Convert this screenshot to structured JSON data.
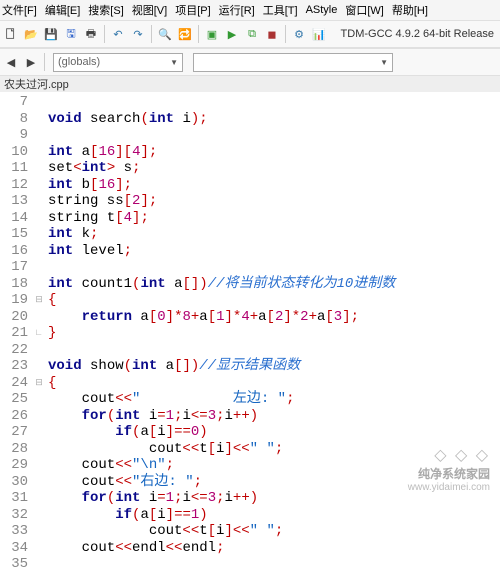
{
  "menus": {
    "file": "文件[F]",
    "edit": "编辑[E]",
    "search": "搜索[S]",
    "view": "视图[V]",
    "project": "项目[P]",
    "run": "运行[R]",
    "tools": "工具[T]",
    "astyle": "AStyle",
    "window": "窗口[W]",
    "help": "帮助[H]"
  },
  "combo": {
    "globals": "(globals)"
  },
  "compiler_label": "TDM-GCC 4.9.2 64-bit Release",
  "tab_title": "农夫过河.cpp",
  "line_start": 7,
  "code_lines": [
    "",
    "<kw>void</kw> <fn>search</fn><pun>(</pun><type>int</type> i<pun>)</pun><pun>;</pun>",
    "",
    "<type>int</type> a<pun>[</pun><num>16</num><pun>]</pun><pun>[</pun><num>4</num><pun>]</pun><pun>;</pun>",
    "set<pun>&lt;</pun><type>int</type><pun>&gt;</pun> s<pun>;</pun>",
    "<type>int</type> b<pun>[</pun><num>16</num><pun>]</pun><pun>;</pun>",
    "string ss<pun>[</pun><num>2</num><pun>]</pun><pun>;</pun>",
    "string t<pun>[</pun><num>4</num><pun>]</pun><pun>;</pun>",
    "<type>int</type> k<pun>;</pun>",
    "<type>int</type> level<pun>;</pun>",
    "",
    "<type>int</type> <fn>count1</fn><pun>(</pun><type>int</type> a<pun>[</pun><pun>]</pun><pun>)</pun><cmt>//将当前状态转化为10进制数</cmt>",
    "<pun>{</pun>",
    "    <kw>return</kw> a<pun>[</pun><num>0</num><pun>]</pun><pun>*</pun><num>8</num><pun>+</pun>a<pun>[</pun><num>1</num><pun>]</pun><pun>*</pun><num>4</num><pun>+</pun>a<pun>[</pun><num>2</num><pun>]</pun><pun>*</pun><num>2</num><pun>+</pun>a<pun>[</pun><num>3</num><pun>]</pun><pun>;</pun>",
    "<pun>}</pun>",
    "",
    "<kw>void</kw> <fn>show</fn><pun>(</pun><type>int</type> a<pun>[</pun><pun>]</pun><pun>)</pun><cmt>//显示结果函数</cmt>",
    "<pun>{</pun>",
    "    cout<pun>&lt;&lt;</pun><str>\"           左边: \"</str><pun>;</pun>",
    "    <kw>for</kw><pun>(</pun><type>int</type> i<pun>=</pun><num>1</num><pun>;</pun>i<pun>&lt;=</pun><num>3</num><pun>;</pun>i<pun>++</pun><pun>)</pun>",
    "        <kw>if</kw><pun>(</pun>a<pun>[</pun>i<pun>]</pun><pun>==</pun><num>0</num><pun>)</pun>",
    "            cout<pun>&lt;&lt;</pun>t<pun>[</pun>i<pun>]</pun><pun>&lt;&lt;</pun><str>\" \"</str><pun>;</pun>",
    "    cout<pun>&lt;&lt;</pun><str>\"\\n\"</str><pun>;</pun>",
    "    cout<pun>&lt;&lt;</pun><str>\"右边: \"</str><pun>;</pun>",
    "    <kw>for</kw><pun>(</pun><type>int</type> i<pun>=</pun><num>1</num><pun>;</pun>i<pun>&lt;=</pun><num>3</num><pun>;</pun>i<pun>++</pun><pun>)</pun>",
    "        <kw>if</kw><pun>(</pun>a<pun>[</pun>i<pun>]</pun><pun>==</pun><num>1</num><pun>)</pun>",
    "            cout<pun>&lt;&lt;</pun>t<pun>[</pun>i<pun>]</pun><pun>&lt;&lt;</pun><str>\" \"</str><pun>;</pun>",
    "    cout<pun>&lt;&lt;</pun>endl<pun>&lt;&lt;</pun>endl<pun>;</pun>"
  ],
  "fold_map": {
    "19": "⊟",
    "21": "∟",
    "24": "⊟",
    "35": "∟"
  },
  "watermark": {
    "logo": "◇ ◇ ◇",
    "title": "纯净系统家园",
    "url": "www.yidaimei.com"
  }
}
